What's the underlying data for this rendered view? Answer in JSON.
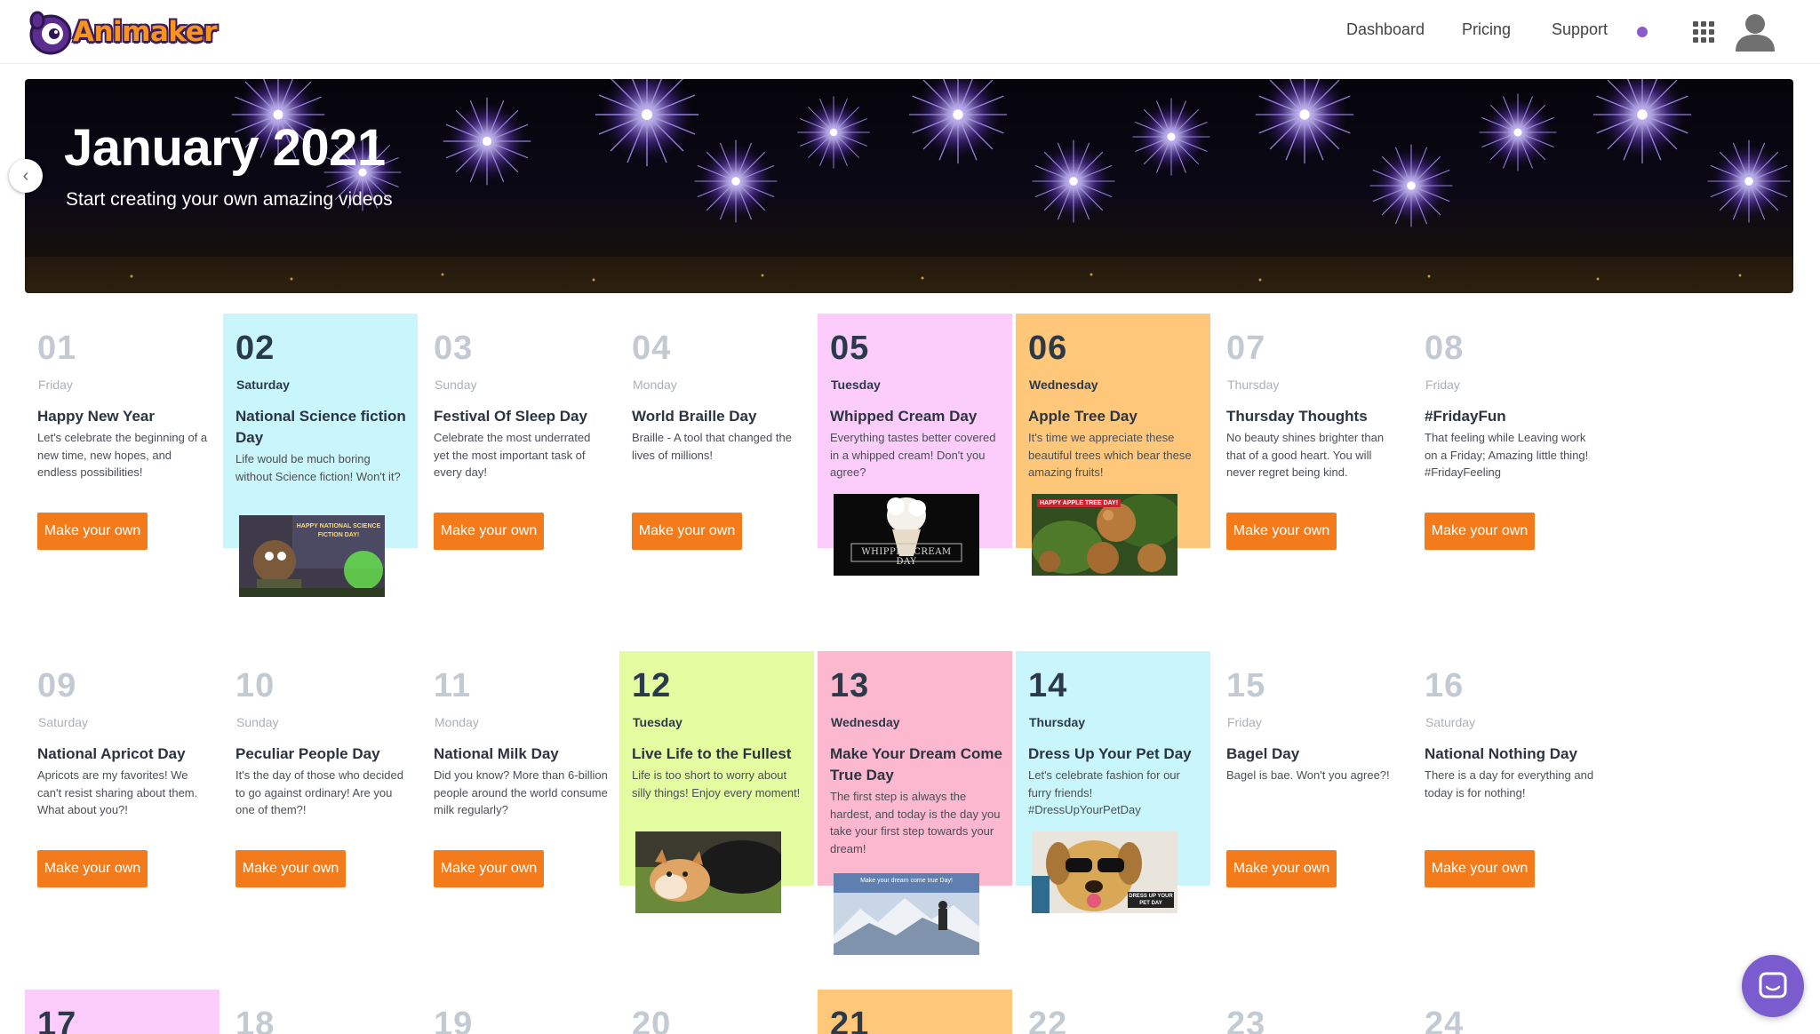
{
  "header": {
    "brand": "Animaker",
    "nav": [
      {
        "label": "Dashboard"
      },
      {
        "label": "Pricing"
      },
      {
        "label": "Support"
      }
    ]
  },
  "banner": {
    "title": "January 2021",
    "subtitle": "Start creating your own amazing videos"
  },
  "colors": {
    "accent_button": "#f47b1c",
    "cyan": "#c9f6fb",
    "pink": "#fccdfb",
    "orange": "#ffc779",
    "lime": "#e3fca0",
    "rose": "#fcb8cf"
  },
  "days": [
    {
      "num": "01",
      "dow": "Friday",
      "title": "Happy New Year",
      "desc": "Let's celebrate the beginning of a new time, new hopes, and endless possibilities!",
      "button": "Make your own"
    },
    {
      "num": "02",
      "dow": "Saturday",
      "title": "National Science fiction Day",
      "desc": "Life would be much boring without Science fiction! Won't it?",
      "thumb_text": "HAPPY NATIONAL SCIENCE FICTION DAY!"
    },
    {
      "num": "03",
      "dow": "Sunday",
      "title": "Festival Of Sleep Day",
      "desc": "Celebrate the most underrated yet the most important task of every day!",
      "button": "Make your own"
    },
    {
      "num": "04",
      "dow": "Monday",
      "title": "World Braille Day",
      "desc": "Braille - A tool that changed the lives of millions!",
      "button": "Make your own"
    },
    {
      "num": "05",
      "dow": "Tuesday",
      "title": "Whipped Cream Day",
      "desc": "Everything tastes better covered in a whipped cream! Don't you agree?",
      "thumb_text": "WHIPPED CREAM DAY"
    },
    {
      "num": "06",
      "dow": "Wednesday",
      "title": "Apple Tree Day",
      "desc": "It's time we appreciate these beautiful trees which bear these amazing fruits!",
      "thumb_text": "HAPPY APPLE TREE DAY!"
    },
    {
      "num": "07",
      "dow": "Thursday",
      "title": "Thursday Thoughts",
      "desc": "No beauty shines brighter than that of a good heart. You will never regret being kind.",
      "button": "Make your own"
    },
    {
      "num": "08",
      "dow": "Friday",
      "title": "#FridayFun",
      "desc": "That feeling while Leaving work on a Friday; Amazing little thing! #FridayFeeling",
      "button": "Make your own"
    },
    {
      "num": "09",
      "dow": "Saturday",
      "title": "National Apricot Day",
      "desc": "Apricots are my favorites! We can't resist sharing about them. What about you?!",
      "button": "Make your own"
    },
    {
      "num": "10",
      "dow": "Sunday",
      "title": "Peculiar People Day",
      "desc": "It's the day of those who decided to go against ordinary! Are you one of them?!",
      "button": "Make your own"
    },
    {
      "num": "11",
      "dow": "Monday",
      "title": "National Milk Day",
      "desc": "Did you know? More than 6-billion people around the world consume milk regularly?",
      "button": "Make your own"
    },
    {
      "num": "12",
      "dow": "Tuesday",
      "title": "Live Life to the Fullest",
      "desc": "Life is too short to worry about silly things! Enjoy every moment!"
    },
    {
      "num": "13",
      "dow": "Wednesday",
      "title": "Make Your Dream Come True Day",
      "desc": "The first step is always the hardest, and today is the day you take your first step towards your dream!",
      "thumb_text": "Make your dream come true Day!"
    },
    {
      "num": "14",
      "dow": "Thursday",
      "title": "Dress Up Your Pet Day",
      "desc": "Let's celebrate fashion for our furry friends! #DressUpYourPetDay",
      "thumb_text": "DRESS UP YOUR PET DAY"
    },
    {
      "num": "15",
      "dow": "Friday",
      "title": "Bagel Day",
      "desc": "Bagel is bae. Won't you agree?!",
      "button": "Make your own"
    },
    {
      "num": "16",
      "dow": "Saturday",
      "title": "National Nothing Day",
      "desc": "There is a day for everything and today is for nothing!",
      "button": "Make your own"
    },
    {
      "num": "17"
    },
    {
      "num": "18"
    },
    {
      "num": "19"
    },
    {
      "num": "20"
    },
    {
      "num": "21"
    },
    {
      "num": "22"
    },
    {
      "num": "23"
    },
    {
      "num": "24"
    }
  ]
}
